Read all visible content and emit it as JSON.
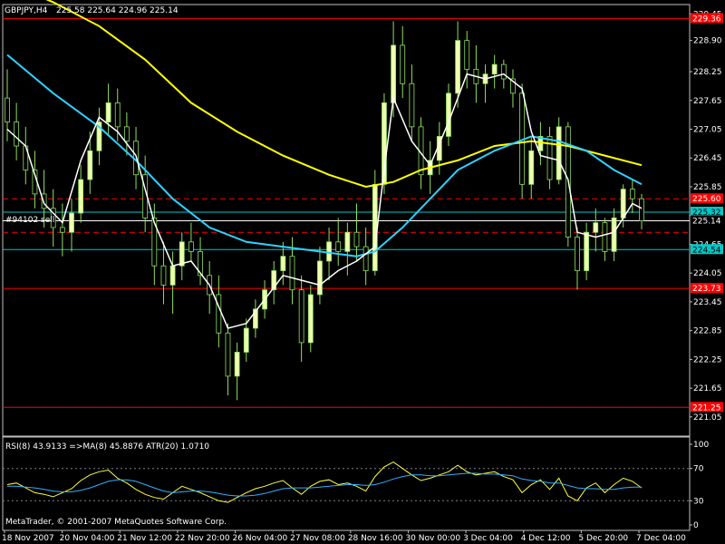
{
  "colors": {
    "background": "#000000",
    "frame": "#c0c0c0",
    "candle_bull": "#ffffff",
    "candle_bear": "#000000",
    "candle_body_fill": "#f0ffb0",
    "wick": "#8fdf60",
    "ma_yellow": "#ffff00",
    "ma_cyan": "#30d0ff",
    "ma_white": "#ffffff",
    "level_red": "#ff0000",
    "level_cyan": "#00c8c8",
    "rsi_line": "#ffff40",
    "rsi_ma": "#30b0ff",
    "text": "#ffffff"
  },
  "chart_data": [
    {
      "type": "candlestick",
      "title": "GBPJPY,H4",
      "ohlc_header": "225.58 225.64 224.96 225.14",
      "ylim": [
        220.65,
        229.65
      ],
      "y_ticks": [
        "229.45",
        "228.90",
        "228.25",
        "227.65",
        "227.05",
        "226.45",
        "225.85",
        "225.25",
        "224.65",
        "224.05",
        "223.45",
        "222.85",
        "222.25",
        "221.65",
        "221.05"
      ],
      "x_ticks": [
        "18 Nov 2007",
        "20 Nov 04:00",
        "21 Nov 12:00",
        "22 Nov 20:00",
        "26 Nov 04:00",
        "27 Nov 08:00",
        "28 Nov 16:00",
        "30 Nov 00:00",
        "3 Dec 04:00",
        "4 Dec 12:00",
        "5 Dec 20:00",
        "7 Dec 04:00"
      ],
      "price_tags": [
        {
          "label": "229.36",
          "value": 229.36,
          "color": "#ff0000"
        },
        {
          "label": "225.60",
          "value": 225.6,
          "color": "#ff0000"
        },
        {
          "label": "225.32",
          "value": 225.32,
          "color": "#00c8c8"
        },
        {
          "label": "225.14",
          "value": 225.14,
          "color": "#ffffff"
        },
        {
          "label": "224.54",
          "value": 224.54,
          "color": "#00c8c8"
        },
        {
          "label": "223.73",
          "value": 223.73,
          "color": "#ff0000"
        },
        {
          "label": "221.25",
          "value": 221.25,
          "color": "#ff0000"
        }
      ],
      "levels": [
        {
          "value": 229.36,
          "color": "#ff0000",
          "dash": false
        },
        {
          "value": 225.6,
          "color": "#ff0000",
          "dash": true
        },
        {
          "value": 225.32,
          "color": "#00c8c8",
          "dash": false
        },
        {
          "value": 225.14,
          "color": "#ffffff",
          "dash": false
        },
        {
          "value": 224.9,
          "color": "#ff0000",
          "dash": true
        },
        {
          "value": 224.54,
          "color": "#00c8c8",
          "dash": false
        },
        {
          "value": 223.73,
          "color": "#ff0000",
          "dash": false
        },
        {
          "value": 221.25,
          "color": "#ff0000",
          "dash": false
        }
      ],
      "order_label": "#94102 sell",
      "candles": [
        [
          227.7,
          228.3,
          226.8,
          227.2
        ],
        [
          227.2,
          227.6,
          226.4,
          226.7
        ],
        [
          226.7,
          227.1,
          225.9,
          226.2
        ],
        [
          226.2,
          226.6,
          225.4,
          225.7
        ],
        [
          225.7,
          226.2,
          225.0,
          225.4
        ],
        [
          225.4,
          225.8,
          224.6,
          225.0
        ],
        [
          225.0,
          225.5,
          224.4,
          224.9
        ],
        [
          224.9,
          225.6,
          224.5,
          225.3
        ],
        [
          225.3,
          226.3,
          225.1,
          226.0
        ],
        [
          226.0,
          227.0,
          225.7,
          226.6
        ],
        [
          226.6,
          227.5,
          226.3,
          227.2
        ],
        [
          227.2,
          228.0,
          226.9,
          227.6
        ],
        [
          227.6,
          227.9,
          226.8,
          227.1
        ],
        [
          227.1,
          227.4,
          226.5,
          226.8
        ],
        [
          226.8,
          227.1,
          225.8,
          226.1
        ],
        [
          226.1,
          226.5,
          224.9,
          225.2
        ],
        [
          225.2,
          225.5,
          223.8,
          224.2
        ],
        [
          224.2,
          224.7,
          223.4,
          223.8
        ],
        [
          223.8,
          224.5,
          223.2,
          224.2
        ],
        [
          224.2,
          224.9,
          223.9,
          224.7
        ],
        [
          224.7,
          225.1,
          224.3,
          224.5
        ],
        [
          224.5,
          224.8,
          223.8,
          224.0
        ],
        [
          224.0,
          224.3,
          223.2,
          223.6
        ],
        [
          223.6,
          224.0,
          222.5,
          222.8
        ],
        [
          222.8,
          223.0,
          221.5,
          221.9
        ],
        [
          221.9,
          222.6,
          221.4,
          222.4
        ],
        [
          222.4,
          223.1,
          222.2,
          222.9
        ],
        [
          222.9,
          223.5,
          222.7,
          223.3
        ],
        [
          223.3,
          223.9,
          223.1,
          223.7
        ],
        [
          223.7,
          224.3,
          223.4,
          224.1
        ],
        [
          224.1,
          224.7,
          223.8,
          224.4
        ],
        [
          224.4,
          224.8,
          223.4,
          223.7
        ],
        [
          223.7,
          224.0,
          222.2,
          222.6
        ],
        [
          222.6,
          223.8,
          222.4,
          223.6
        ],
        [
          223.6,
          224.6,
          223.4,
          224.3
        ],
        [
          224.3,
          225.0,
          223.9,
          224.7
        ],
        [
          224.7,
          225.2,
          224.2,
          224.5
        ],
        [
          224.5,
          225.1,
          224.0,
          224.9
        ],
        [
          224.9,
          225.5,
          224.3,
          224.6
        ],
        [
          224.6,
          225.0,
          223.8,
          224.1
        ],
        [
          224.1,
          226.2,
          224.0,
          225.9
        ],
        [
          225.9,
          227.8,
          225.7,
          227.6
        ],
        [
          227.6,
          229.3,
          227.3,
          228.8
        ],
        [
          228.8,
          229.2,
          227.7,
          228.0
        ],
        [
          228.0,
          228.4,
          226.8,
          227.1
        ],
        [
          227.1,
          227.3,
          225.8,
          226.1
        ],
        [
          226.1,
          226.8,
          225.7,
          226.4
        ],
        [
          226.4,
          227.2,
          226.1,
          226.9
        ],
        [
          226.9,
          228.0,
          226.7,
          227.8
        ],
        [
          227.8,
          229.3,
          227.5,
          228.9
        ],
        [
          228.9,
          229.1,
          227.9,
          228.3
        ],
        [
          228.3,
          228.8,
          227.6,
          228.0
        ],
        [
          228.0,
          228.4,
          227.6,
          228.2
        ],
        [
          228.2,
          228.6,
          227.9,
          228.4
        ],
        [
          228.4,
          228.5,
          227.9,
          228.1
        ],
        [
          228.1,
          228.3,
          227.5,
          227.8
        ],
        [
          227.8,
          228.0,
          225.6,
          225.9
        ],
        [
          225.9,
          226.9,
          225.6,
          226.6
        ],
        [
          226.6,
          227.2,
          226.3,
          226.9
        ],
        [
          226.9,
          227.1,
          225.8,
          226.0
        ],
        [
          226.0,
          227.3,
          225.9,
          227.1
        ],
        [
          227.1,
          227.2,
          224.6,
          224.8
        ],
        [
          224.8,
          225.0,
          223.7,
          224.1
        ],
        [
          224.1,
          225.1,
          223.9,
          224.9
        ],
        [
          224.9,
          225.4,
          224.5,
          225.1
        ],
        [
          225.1,
          225.2,
          224.3,
          224.5
        ],
        [
          224.5,
          225.4,
          224.3,
          225.2
        ],
        [
          225.2,
          225.9,
          225.0,
          225.8
        ],
        [
          225.8,
          226.0,
          225.3,
          225.6
        ],
        [
          225.6,
          225.7,
          224.96,
          225.14
        ]
      ],
      "ma_yellow": [
        [
          0,
          230.1
        ],
        [
          5,
          229.7
        ],
        [
          10,
          229.2
        ],
        [
          15,
          228.5
        ],
        [
          20,
          227.6
        ],
        [
          25,
          227.0
        ],
        [
          30,
          226.5
        ],
        [
          35,
          226.1
        ],
        [
          39,
          225.85
        ],
        [
          42,
          225.95
        ],
        [
          45,
          226.2
        ],
        [
          49,
          226.4
        ],
        [
          53,
          226.7
        ],
        [
          57,
          226.8
        ],
        [
          61,
          226.7
        ],
        [
          65,
          226.5
        ],
        [
          69,
          226.3
        ]
      ],
      "ma_cyan": [
        [
          0,
          228.6
        ],
        [
          5,
          227.8
        ],
        [
          10,
          227.1
        ],
        [
          14,
          226.4
        ],
        [
          18,
          225.6
        ],
        [
          22,
          225.0
        ],
        [
          26,
          224.7
        ],
        [
          30,
          224.6
        ],
        [
          34,
          224.5
        ],
        [
          38,
          224.4
        ],
        [
          40,
          224.5
        ],
        [
          43,
          225.0
        ],
        [
          46,
          225.6
        ],
        [
          49,
          226.2
        ],
        [
          53,
          226.6
        ],
        [
          57,
          226.9
        ],
        [
          60,
          226.8
        ],
        [
          63,
          226.6
        ],
        [
          66,
          226.2
        ],
        [
          69,
          225.9
        ]
      ],
      "ma_white": [
        [
          0,
          227.05
        ],
        [
          2,
          226.7
        ],
        [
          4,
          225.5
        ],
        [
          6,
          225.1
        ],
        [
          8,
          226.4
        ],
        [
          10,
          227.3
        ],
        [
          12,
          227.0
        ],
        [
          14,
          226.5
        ],
        [
          16,
          225.1
        ],
        [
          18,
          224.2
        ],
        [
          20,
          224.3
        ],
        [
          22,
          223.8
        ],
        [
          24,
          222.9
        ],
        [
          26,
          223.0
        ],
        [
          28,
          223.5
        ],
        [
          30,
          224.0
        ],
        [
          32,
          223.9
        ],
        [
          34,
          223.8
        ],
        [
          36,
          224.1
        ],
        [
          38,
          224.3
        ],
        [
          40,
          224.6
        ],
        [
          41,
          226.2
        ],
        [
          42,
          227.7
        ],
        [
          44,
          226.8
        ],
        [
          46,
          226.3
        ],
        [
          48,
          227.2
        ],
        [
          50,
          228.2
        ],
        [
          52,
          228.1
        ],
        [
          54,
          228.2
        ],
        [
          56,
          227.9
        ],
        [
          57,
          227.0
        ],
        [
          58,
          226.5
        ],
        [
          60,
          226.4
        ],
        [
          61,
          226.0
        ],
        [
          62,
          224.9
        ],
        [
          64,
          224.8
        ],
        [
          66,
          224.9
        ],
        [
          68,
          225.5
        ],
        [
          69,
          225.4
        ]
      ]
    },
    {
      "type": "line",
      "title": "RSI(8) 43.9133 =>MA(8) 45.8876 ATR(20) 1.0710",
      "ylim": [
        0,
        100
      ],
      "y_ticks": [
        "100",
        "70",
        "30",
        "0"
      ],
      "levels": [
        70,
        30
      ],
      "rsi": [
        50,
        52,
        46,
        40,
        38,
        35,
        40,
        45,
        55,
        62,
        66,
        68,
        58,
        52,
        44,
        38,
        34,
        32,
        40,
        48,
        44,
        40,
        35,
        30,
        28,
        34,
        40,
        45,
        48,
        52,
        55,
        46,
        38,
        48,
        54,
        56,
        50,
        52,
        48,
        42,
        60,
        72,
        78,
        70,
        62,
        55,
        58,
        62,
        66,
        74,
        66,
        62,
        64,
        66,
        60,
        56,
        40,
        50,
        56,
        44,
        58,
        36,
        30,
        46,
        52,
        40,
        50,
        58,
        54,
        46
      ],
      "rsi_ma": [
        48,
        48,
        47,
        46,
        44,
        42,
        41,
        41,
        43,
        46,
        50,
        54,
        56,
        56,
        54,
        50,
        46,
        42,
        40,
        41,
        42,
        42,
        41,
        39,
        37,
        36,
        36,
        37,
        39,
        42,
        45,
        46,
        46,
        46,
        47,
        48,
        49,
        50,
        50,
        49,
        50,
        53,
        57,
        60,
        62,
        62,
        61,
        61,
        62,
        63,
        64,
        64,
        63,
        63,
        62,
        61,
        57,
        55,
        54,
        52,
        52,
        49,
        46,
        45,
        45,
        44,
        44,
        46,
        47,
        47
      ]
    }
  ],
  "copyright": "MetaTrader, © 2001-2007 MetaQuotes Software Corp."
}
